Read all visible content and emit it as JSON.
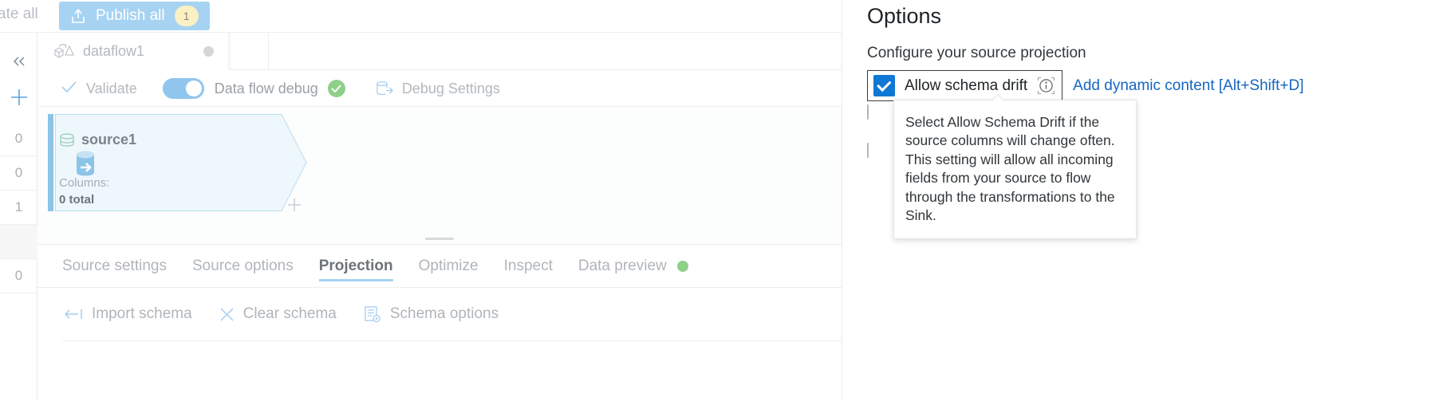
{
  "commandbar": {
    "validate_all_label": "lidate all",
    "publish_label": "Publish all",
    "publish_badge": "1",
    "publish_icon": "upload-icon"
  },
  "sidebar": {
    "collapse_icon": "chevron-double-left-icon",
    "add_icon": "plus-icon",
    "counts": [
      "0",
      "0",
      "1",
      "",
      "0"
    ]
  },
  "dataflow_tab": {
    "label": "dataflow1",
    "icon": "dataflow-icon",
    "status_dot": "grey-dot"
  },
  "actions": {
    "validate_label": "Validate",
    "validate_icon": "checkmark-icon",
    "debug_toggle_label": "Data flow debug",
    "debug_toggle_state": "on",
    "debug_status_icon": "success-check-icon",
    "debug_settings_label": "Debug Settings",
    "debug_settings_icon": "database-export-icon"
  },
  "canvas": {
    "node": {
      "name": "source1",
      "name_icon": "database-stack-icon",
      "source_icon": "source-database-icon",
      "columns_label": "Columns:",
      "columns_value": "0 total",
      "add_icon": "plus-icon"
    }
  },
  "bottom_tabs": [
    {
      "label": "Source settings",
      "active": false,
      "dot": false
    },
    {
      "label": "Source options",
      "active": false,
      "dot": false
    },
    {
      "label": "Projection",
      "active": true,
      "dot": false
    },
    {
      "label": "Optimize",
      "active": false,
      "dot": false
    },
    {
      "label": "Inspect",
      "active": false,
      "dot": false
    },
    {
      "label": "Data preview",
      "active": false,
      "dot": true
    }
  ],
  "schema_toolbar": [
    {
      "label": "Import schema",
      "icon": "import-arrow-icon"
    },
    {
      "label": "Clear schema",
      "icon": "close-x-icon"
    },
    {
      "label": "Schema options",
      "icon": "schema-options-icon"
    }
  ],
  "options_panel": {
    "title": "Options",
    "subtitle": "Configure your source projection",
    "schema_drift": {
      "label": "Allow schema drift",
      "checked": true,
      "info_icon": "info-circle-icon"
    },
    "dynamic_content_link": "Add dynamic content [Alt+Shift+D]",
    "tooltip_text": "Select Allow Schema Drift if the source columns will change often. This setting will allow all incoming fields from your source to flow through the transformations to the Sink.",
    "extra_options": [
      {
        "checked": false
      },
      {
        "checked": false
      }
    ]
  },
  "colors": {
    "accent_blue": "#0f78d4",
    "link_blue": "#1566c0",
    "publish_blue": "#a6d3f2",
    "badge_cream": "#fbf0c4",
    "node_fill": "#eef7fc",
    "node_border": "#bcdcf1",
    "success_green": "#8ed08a"
  }
}
